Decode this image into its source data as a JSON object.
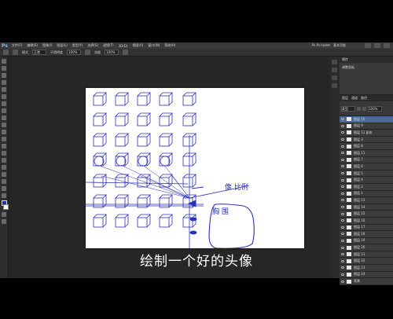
{
  "menu": {
    "app_logo": "Ps",
    "items": [
      "文件(F)",
      "编辑(E)",
      "图像(I)",
      "图层(L)",
      "类型(Y)",
      "选择(S)",
      "滤镜(T)",
      "3D(D)",
      "视图(V)",
      "窗口(W)",
      "帮助(H)"
    ],
    "right_items": [
      "Ps·Ps·tablet",
      "基本功能"
    ]
  },
  "options_bar": {
    "items": [
      "模式",
      "正常",
      "不透明度",
      "100%",
      "流量",
      "100%"
    ]
  },
  "panels": {
    "properties_tab": "属性",
    "properties_subtab": "调整面板",
    "layers_tabs": [
      "图层",
      "通道",
      "路径"
    ],
    "kind_filter": "类型",
    "opacity": "100%",
    "layers": [
      {
        "name": "图层 10",
        "selected": true
      },
      {
        "name": "图层 9",
        "selected": false
      },
      {
        "name": "图层 12 副本",
        "selected": false
      },
      {
        "name": "图层 3",
        "selected": false
      },
      {
        "name": "图层 8",
        "selected": false
      },
      {
        "name": "图层 11",
        "selected": false
      },
      {
        "name": "图层 7",
        "selected": false
      },
      {
        "name": "图层 6",
        "selected": false
      },
      {
        "name": "图层 5",
        "selected": false
      },
      {
        "name": "图层 4",
        "selected": false
      },
      {
        "name": "图层 2",
        "selected": false
      },
      {
        "name": "图层 1",
        "selected": false
      },
      {
        "name": "图层 13",
        "selected": false
      },
      {
        "name": "图层 14",
        "selected": false
      },
      {
        "name": "图层 15",
        "selected": false
      },
      {
        "name": "图层 16",
        "selected": false
      },
      {
        "name": "图层 17",
        "selected": false
      },
      {
        "name": "图层 18",
        "selected": false
      },
      {
        "name": "图层 19",
        "selected": false
      },
      {
        "name": "图层 20",
        "selected": false
      },
      {
        "name": "图层 21",
        "selected": false
      },
      {
        "name": "图层 22",
        "selected": false
      },
      {
        "name": "图层 23",
        "selected": false
      },
      {
        "name": "图层 24",
        "selected": false
      },
      {
        "name": "背景",
        "selected": false
      }
    ]
  },
  "canvas": {
    "handwriting_note_1": "像 比例",
    "handwriting_note_2": "胸 围",
    "pencil_color": "#2b2fb8"
  },
  "subtitle": "绘制一个好的头像"
}
